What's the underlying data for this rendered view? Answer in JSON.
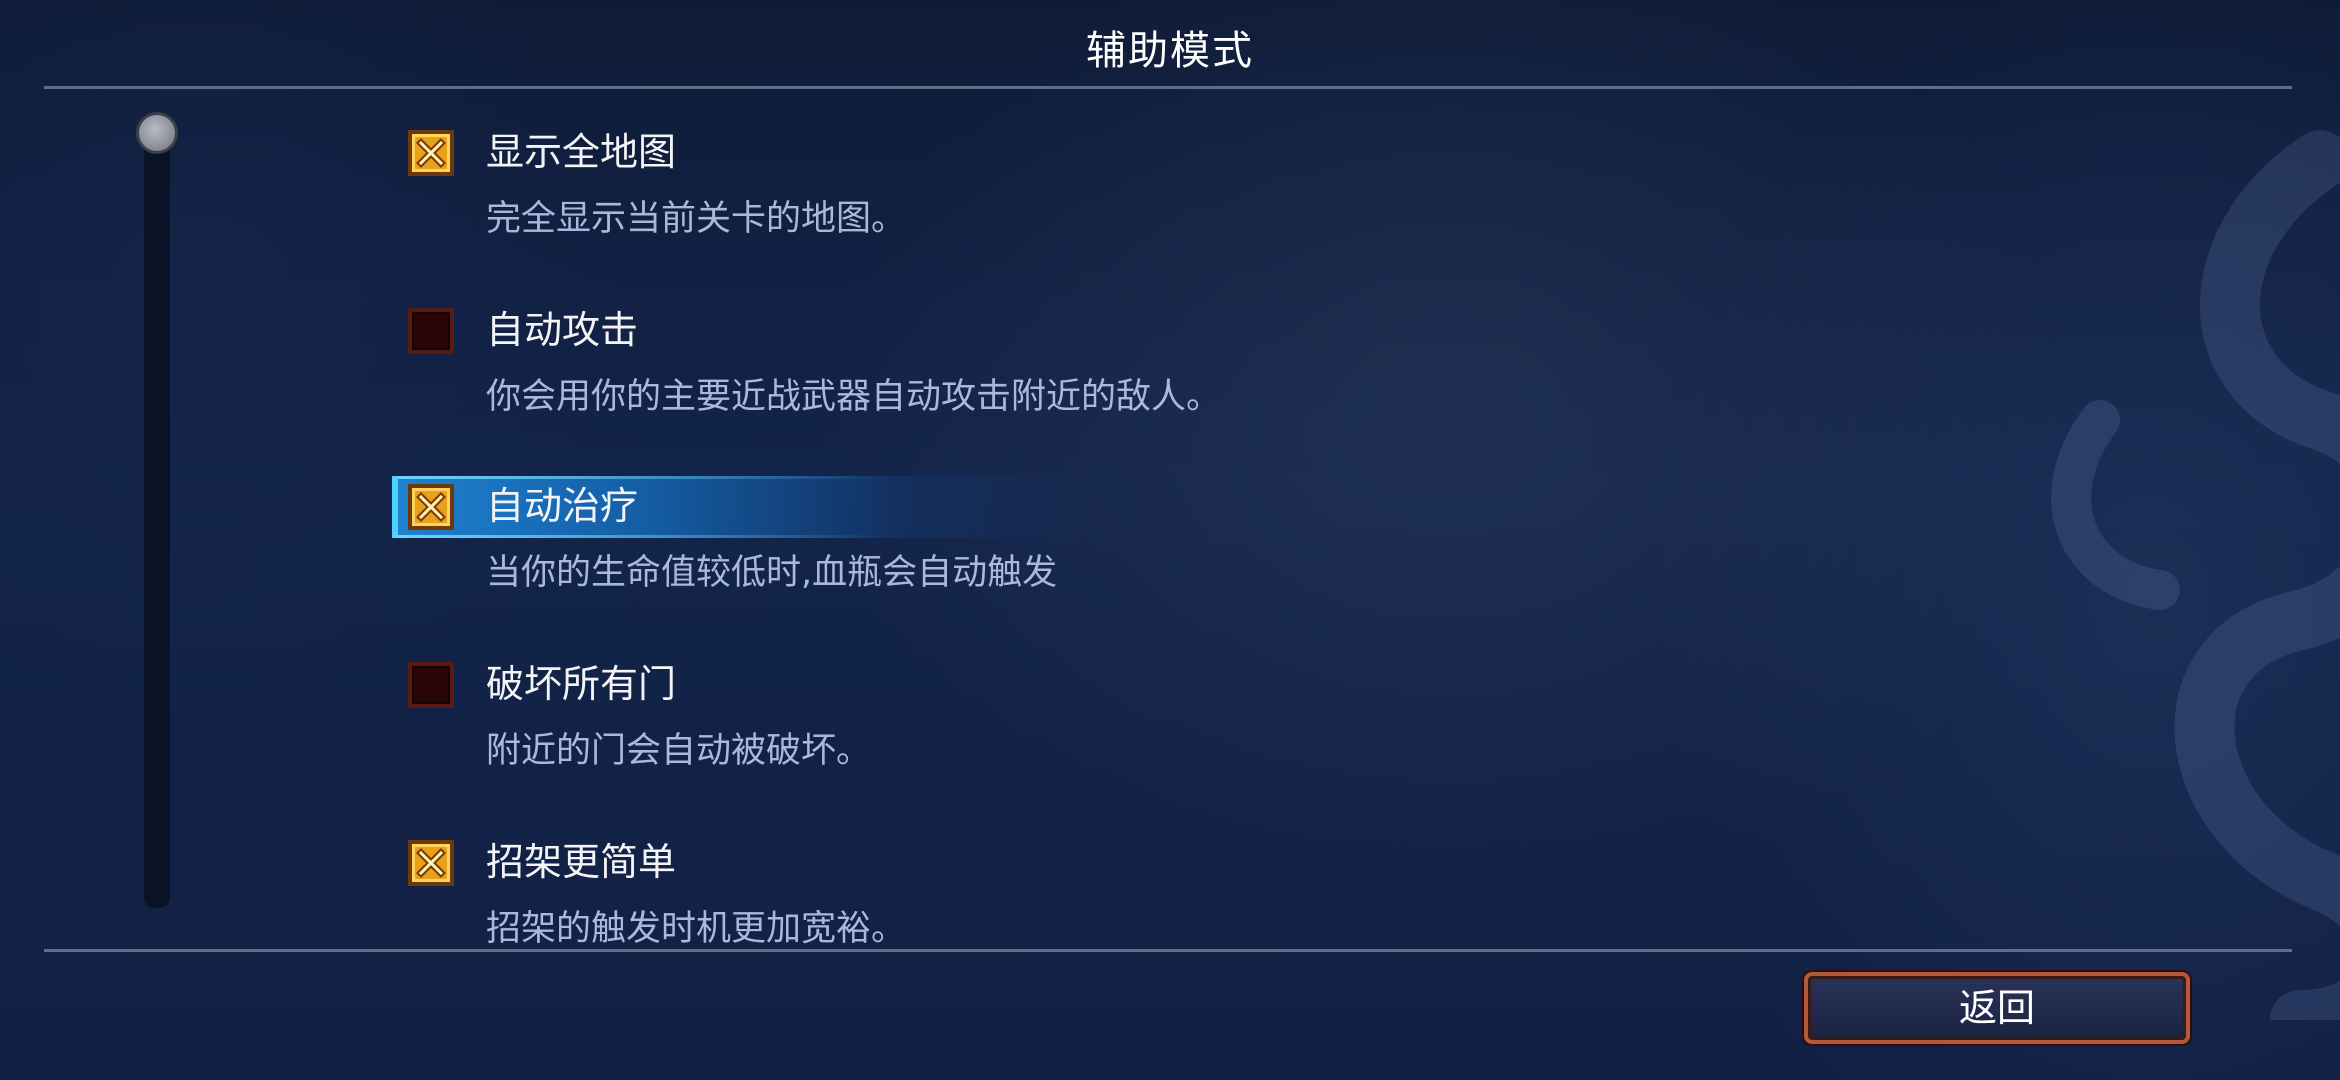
{
  "header": {
    "title": "辅助模式"
  },
  "options": [
    {
      "label": "显示全地图",
      "description": "完全显示当前关卡的地图。",
      "checked": true,
      "selected": false
    },
    {
      "label": "自动攻击",
      "description": "你会用你的主要近战武器自动攻击附近的敌人。",
      "checked": false,
      "selected": false
    },
    {
      "label": "自动治疗",
      "description": "当你的生命值较低时,血瓶会自动触发",
      "checked": true,
      "selected": true
    },
    {
      "label": "破坏所有门",
      "description": "附近的门会自动被破坏。",
      "checked": false,
      "selected": false
    },
    {
      "label": "招架更简单",
      "description": "招架的触发时机更加宽裕。",
      "checked": true,
      "selected": false
    }
  ],
  "footer": {
    "back_label": "返回"
  },
  "scrollbar": {
    "position": 0.0
  },
  "colors": {
    "checkbox_checked": "#e8a11a",
    "checkbox_unchecked": "#2a0508",
    "highlight": "#1f86d6",
    "button_border": "#b3583c"
  }
}
